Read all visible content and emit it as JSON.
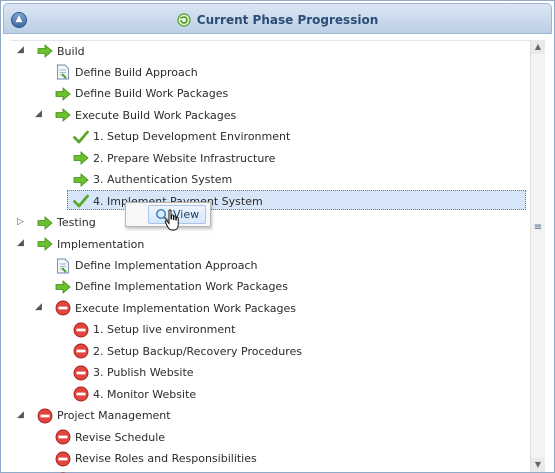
{
  "header": {
    "title": "Current Phase Progression",
    "collapse_icon": "chevron-up-icon",
    "title_icon": "refresh-icon"
  },
  "tree": {
    "rows": [
      {
        "label": "Build",
        "icon": "green-arrow-icon",
        "level": 0,
        "toggle": "expanded"
      },
      {
        "label": "Define Build Approach",
        "icon": "document-icon",
        "level": 1,
        "toggle": "none"
      },
      {
        "label": "Define Build Work Packages",
        "icon": "green-arrow-icon",
        "level": 1,
        "toggle": "none"
      },
      {
        "label": "Execute Build Work Packages",
        "icon": "green-arrow-icon",
        "level": 1,
        "toggle": "expanded"
      },
      {
        "label": "1. Setup Development Environment",
        "icon": "checkmark-icon",
        "level": 2,
        "toggle": "none"
      },
      {
        "label": "2. Prepare Website Infrastructure",
        "icon": "green-arrow-icon",
        "level": 2,
        "toggle": "none"
      },
      {
        "label": "3. Authentication System",
        "icon": "green-arrow-icon",
        "level": 2,
        "toggle": "none"
      },
      {
        "label": "4. Implement Payment System",
        "icon": "checkmark-icon",
        "level": 2,
        "toggle": "none",
        "selected": true
      },
      {
        "label": "Testing",
        "icon": "green-arrow-icon",
        "level": 0,
        "toggle": "collapsed"
      },
      {
        "label": "Implementation",
        "icon": "green-arrow-icon",
        "level": 0,
        "toggle": "expanded"
      },
      {
        "label": "Define Implementation Approach",
        "icon": "document-icon",
        "level": 1,
        "toggle": "none"
      },
      {
        "label": "Define Implementation Work Packages",
        "icon": "green-arrow-icon",
        "level": 1,
        "toggle": "none"
      },
      {
        "label": "Execute Implementation Work Packages",
        "icon": "red-stop-icon",
        "level": 1,
        "toggle": "expanded"
      },
      {
        "label": "1. Setup live environment",
        "icon": "red-stop-icon",
        "level": 2,
        "toggle": "none"
      },
      {
        "label": "2. Setup Backup/Recovery Procedures",
        "icon": "red-stop-icon",
        "level": 2,
        "toggle": "none"
      },
      {
        "label": "3. Publish Website",
        "icon": "red-stop-icon",
        "level": 2,
        "toggle": "none"
      },
      {
        "label": "4. Monitor Website",
        "icon": "red-stop-icon",
        "level": 2,
        "toggle": "none"
      },
      {
        "label": "Project Management",
        "icon": "red-stop-icon",
        "level": 0,
        "toggle": "expanded"
      },
      {
        "label": "Revise Schedule",
        "icon": "red-stop-icon",
        "level": 1,
        "toggle": "none"
      },
      {
        "label": "Revise Roles and Responsibilities",
        "icon": "red-stop-icon",
        "level": 1,
        "toggle": "none"
      },
      {
        "label": "",
        "icon": "red-stop-icon",
        "level": 1,
        "toggle": "none"
      }
    ]
  },
  "context_menu": {
    "view_label": "View",
    "view_icon": "magnifier-icon"
  },
  "colors": {
    "green": "#5aa82a",
    "red": "#d2302a",
    "accent": "#2c4d75"
  }
}
